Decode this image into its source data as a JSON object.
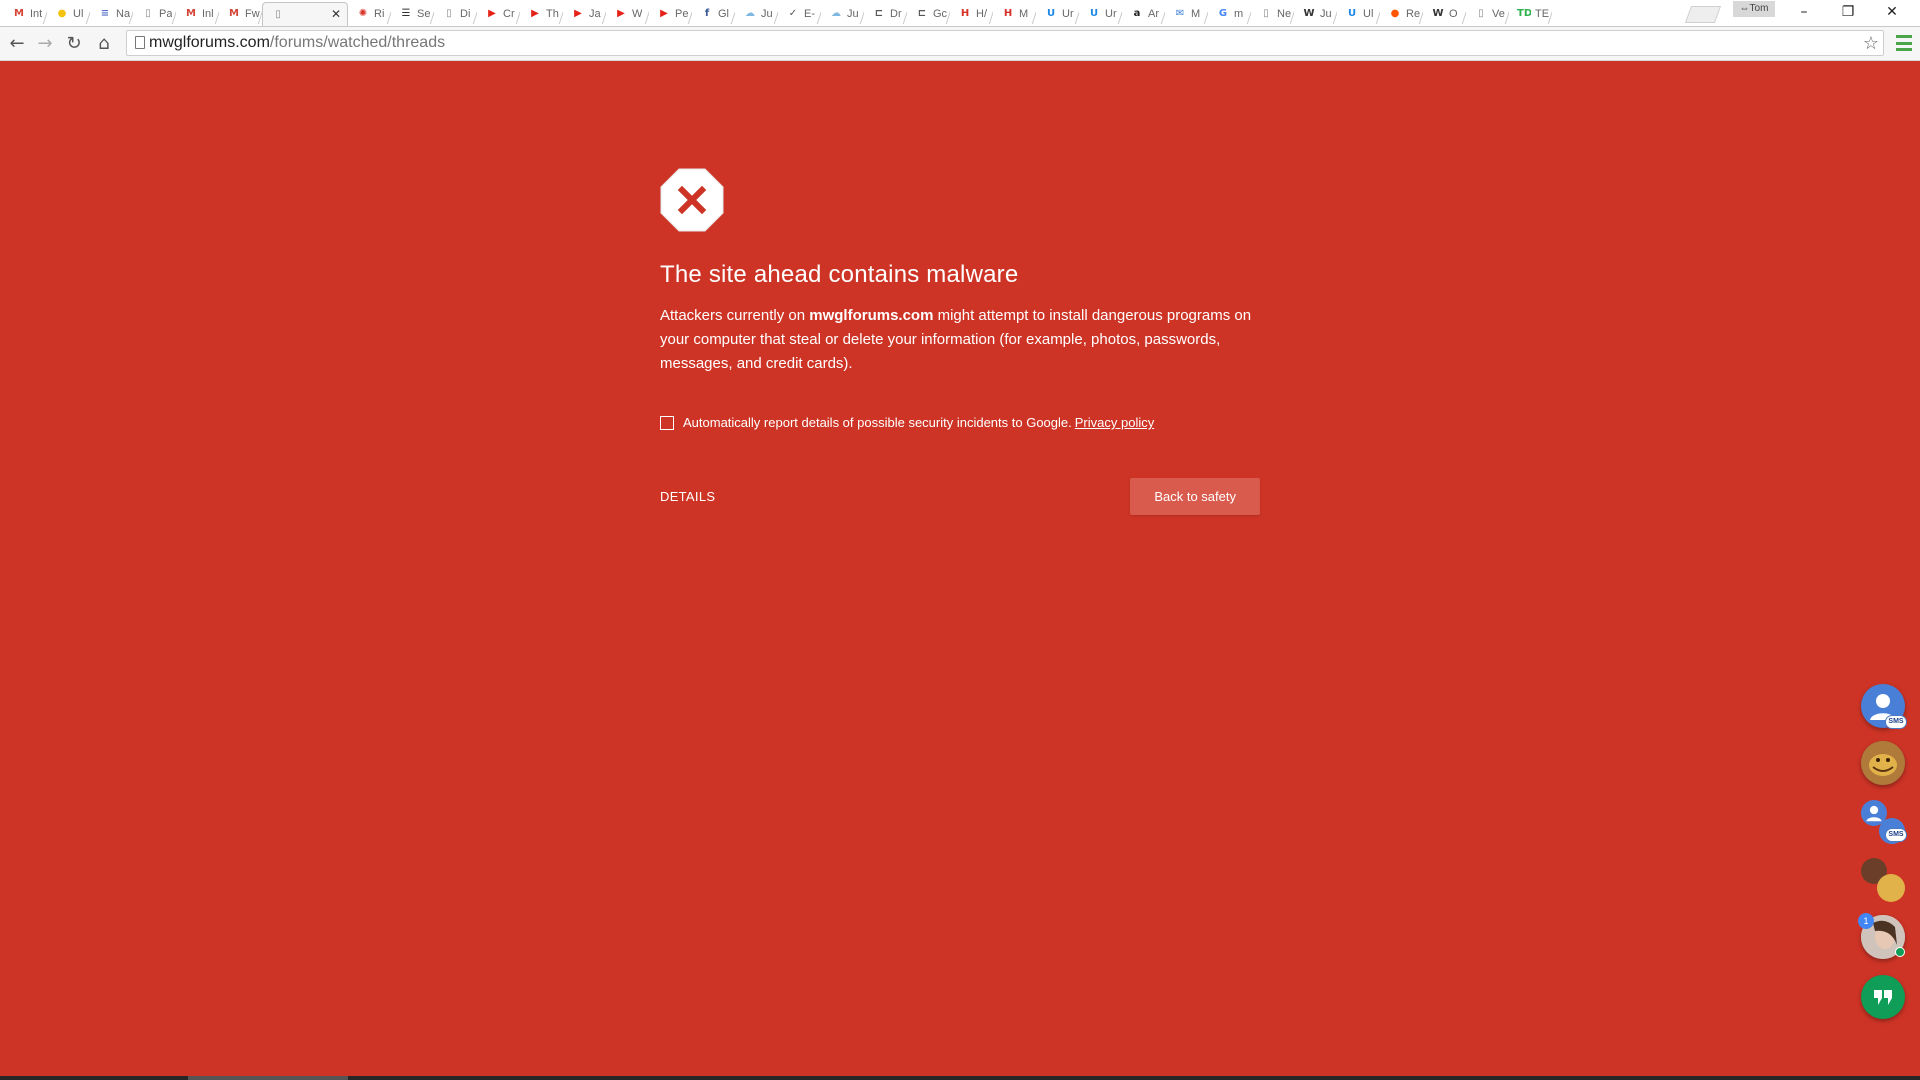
{
  "browser": {
    "tabs": [
      {
        "title": "Int",
        "icon": "gmail-icon",
        "color": "#d44638",
        "glyph": "M"
      },
      {
        "title": "Ul",
        "icon": "yellow-circle-icon",
        "color": "#f4c20d",
        "glyph": "●"
      },
      {
        "title": "Na",
        "icon": "list-icon",
        "color": "#5870c8",
        "glyph": "≡"
      },
      {
        "title": "Pa",
        "icon": "page-icon",
        "color": "#888888",
        "glyph": "▯"
      },
      {
        "title": "Inl",
        "icon": "gmail-icon",
        "color": "#d44638",
        "glyph": "M"
      },
      {
        "title": "Fw",
        "icon": "gmail-icon",
        "color": "#d44638",
        "glyph": "M"
      },
      {
        "title": "",
        "icon": "page-icon",
        "color": "#888888",
        "glyph": "▯",
        "active": true
      },
      {
        "title": "Ri",
        "icon": "gear-red-icon",
        "color": "#d93025",
        "glyph": "✺"
      },
      {
        "title": "Se",
        "icon": "doc-icon",
        "color": "#333333",
        "glyph": "☰"
      },
      {
        "title": "Di",
        "icon": "page-icon",
        "color": "#888888",
        "glyph": "▯"
      },
      {
        "title": "Cr",
        "icon": "youtube-icon",
        "color": "#e62117",
        "glyph": "▶"
      },
      {
        "title": "Th",
        "icon": "youtube-icon",
        "color": "#e62117",
        "glyph": "▶"
      },
      {
        "title": "Ja",
        "icon": "youtube-icon",
        "color": "#e62117",
        "glyph": "▶"
      },
      {
        "title": "W",
        "icon": "youtube-icon",
        "color": "#e62117",
        "glyph": "▶"
      },
      {
        "title": "Pe",
        "icon": "youtube-icon",
        "color": "#e62117",
        "glyph": "▶"
      },
      {
        "title": "Gl",
        "icon": "facebook-icon",
        "color": "#3b5998",
        "glyph": "f"
      },
      {
        "title": "Ju",
        "icon": "cloud-icon",
        "color": "#7fb8e0",
        "glyph": "☁"
      },
      {
        "title": "E-",
        "icon": "chevron-icon",
        "color": "#555555",
        "glyph": "✓"
      },
      {
        "title": "Ju",
        "icon": "cloud-icon",
        "color": "#7fb8e0",
        "glyph": "☁"
      },
      {
        "title": "Dr",
        "icon": "link-icon",
        "color": "#555555",
        "glyph": "⊏"
      },
      {
        "title": "Gc",
        "icon": "link-icon",
        "color": "#555555",
        "glyph": "⊏"
      },
      {
        "title": "H/",
        "icon": "bracket-icon",
        "color": "#d93025",
        "glyph": "H"
      },
      {
        "title": "M",
        "icon": "bracket-icon",
        "color": "#d93025",
        "glyph": "H"
      },
      {
        "title": "Ur",
        "icon": "u-icon",
        "color": "#1e88e5",
        "glyph": "U"
      },
      {
        "title": "Ur",
        "icon": "u-icon",
        "color": "#1e88e5",
        "glyph": "U"
      },
      {
        "title": "Ar",
        "icon": "amazon-icon",
        "color": "#222222",
        "glyph": "a"
      },
      {
        "title": "M",
        "icon": "mail-icon",
        "color": "#3c7fd6",
        "glyph": "✉"
      },
      {
        "title": "m",
        "icon": "google-icon",
        "color": "#4285f4",
        "glyph": "G"
      },
      {
        "title": "Ne",
        "icon": "page-icon",
        "color": "#888888",
        "glyph": "▯"
      },
      {
        "title": "Ju",
        "icon": "wikipedia-icon",
        "color": "#333333",
        "glyph": "W"
      },
      {
        "title": "Ul",
        "icon": "u-icon",
        "color": "#1e88e5",
        "glyph": "U"
      },
      {
        "title": "Re",
        "icon": "reddit-icon",
        "color": "#ff5700",
        "glyph": "●"
      },
      {
        "title": "O",
        "icon": "wikipedia-icon",
        "color": "#333333",
        "glyph": "W"
      },
      {
        "title": "Ve",
        "icon": "page-icon",
        "color": "#888888",
        "glyph": "▯"
      },
      {
        "title": "TE",
        "icon": "td-icon",
        "color": "#2bb24c",
        "glyph": "TD"
      }
    ],
    "profile_name": "Tom",
    "url_host": "mwglforums.com",
    "url_path": "/forums/watched/threads"
  },
  "interstitial": {
    "heading": "The site ahead contains malware",
    "msg_before": "Attackers currently on ",
    "msg_host": "mwglforums.com",
    "msg_after": " might attempt to install dangerous programs on your computer that steal or delete your information (for example, photos, passwords, messages, and credit cards).",
    "report_label": "Automatically report details of possible security incidents to Google.",
    "privacy_link": "Privacy policy",
    "details_label": "DETAILS",
    "back_label": "Back to safety",
    "background_color": "#ce3426",
    "button_color": "#d95b4e"
  },
  "hangouts": {
    "sms_label": "SMS",
    "unread_count": "1"
  }
}
